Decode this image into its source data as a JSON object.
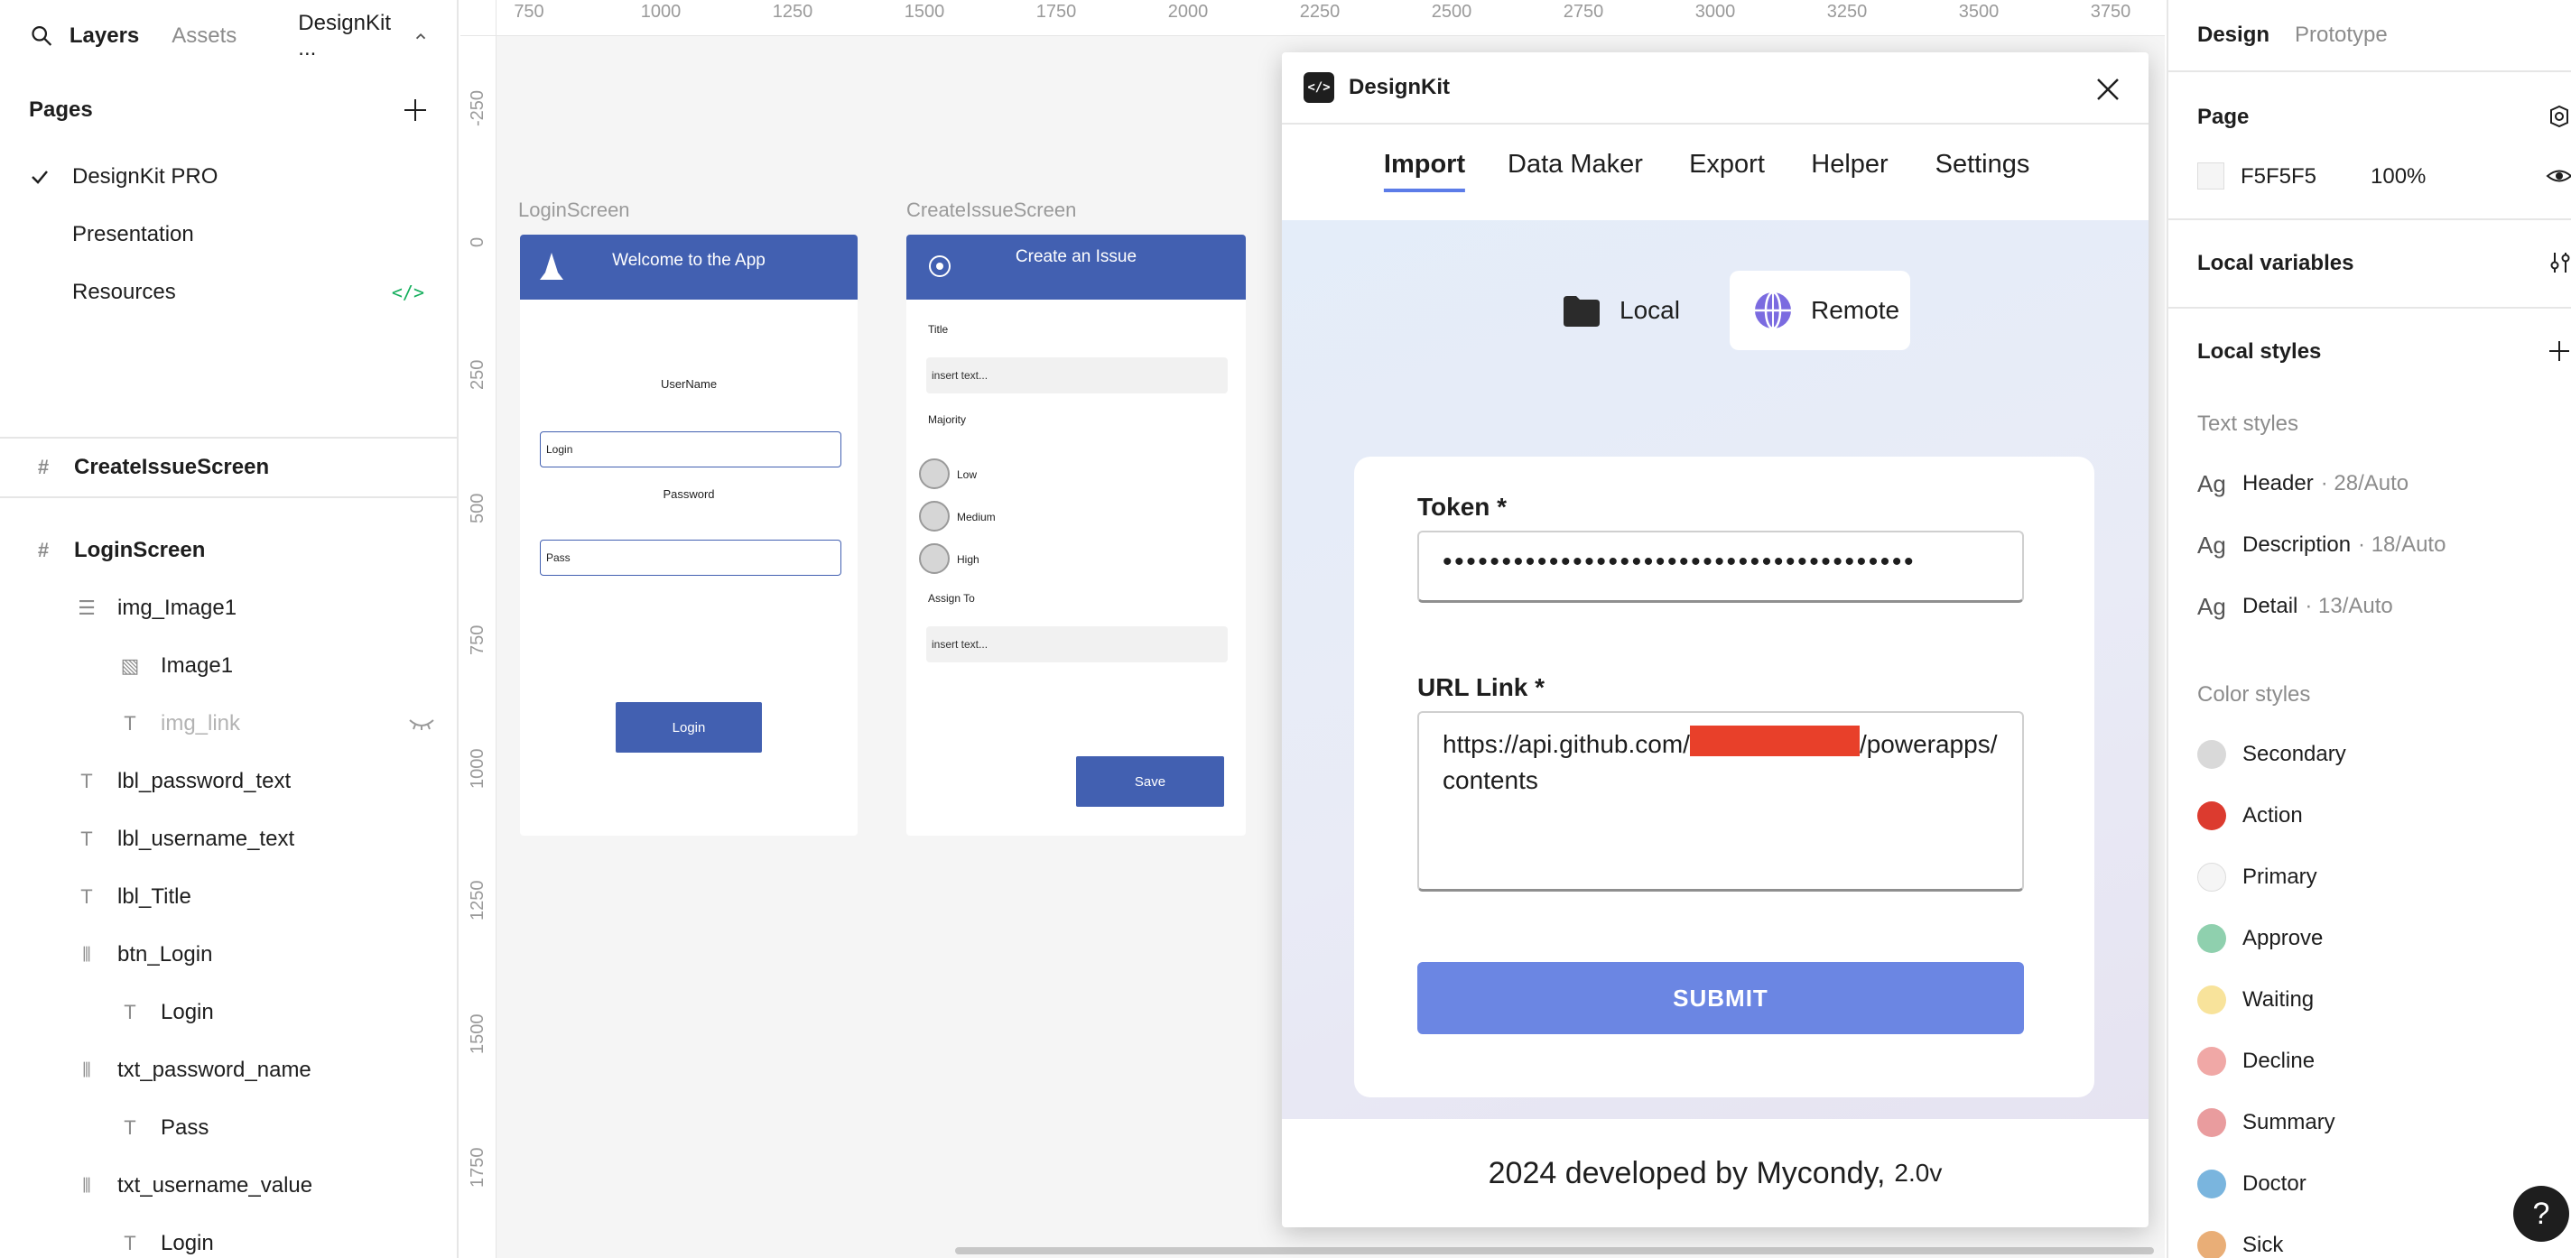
{
  "left_panel": {
    "tabs": {
      "layers": "Layers",
      "assets": "Assets"
    },
    "file_name": "DesignKit ...",
    "pages_heading": "Pages",
    "pages": [
      {
        "label": "DesignKit PRO",
        "selected": true
      },
      {
        "label": "Presentation",
        "selected": false
      },
      {
        "label": "Resources",
        "selected": false,
        "badge": "</>"
      }
    ],
    "layers": [
      {
        "label": "CreateIssueScreen",
        "kind": "frame"
      },
      {
        "label": "LoginScreen",
        "kind": "frame"
      },
      {
        "label": "img_Image1",
        "kind": "group"
      },
      {
        "label": "Image1",
        "kind": "image"
      },
      {
        "label": "img_link",
        "kind": "text",
        "hidden": true
      },
      {
        "label": "lbl_password_text",
        "kind": "text"
      },
      {
        "label": "lbl_username_text",
        "kind": "text"
      },
      {
        "label": "lbl_Title",
        "kind": "text"
      },
      {
        "label": "btn_Login",
        "kind": "auto-layout"
      },
      {
        "label": "Login",
        "kind": "text"
      },
      {
        "label": "txt_password_name",
        "kind": "auto-layout"
      },
      {
        "label": "Pass",
        "kind": "text"
      },
      {
        "label": "txt_username_value",
        "kind": "auto-layout"
      },
      {
        "label": "Login",
        "kind": "text"
      }
    ]
  },
  "canvas": {
    "background": "#F5F5F5",
    "ruler_x": [
      "750",
      "1000",
      "1250",
      "1500",
      "1750",
      "2000",
      "2250",
      "2500",
      "2750",
      "3000",
      "3250",
      "3500",
      "3750"
    ],
    "ruler_y": [
      "-250",
      "0",
      "250",
      "500",
      "750",
      "1000",
      "1250",
      "1500",
      "1750"
    ],
    "login_screen": {
      "frame_label": "LoginScreen",
      "header": "Welcome to the App",
      "username_label": "UserName",
      "username_value": "Login",
      "password_label": "Password",
      "password_value": "Pass",
      "button": "Login"
    },
    "create_issue_screen": {
      "frame_label": "CreateIssueScreen",
      "header": "Create an Issue",
      "title_label": "Title",
      "title_placeholder": "insert text...",
      "majority_label": "Majority",
      "options": [
        "Low",
        "Medium",
        "High"
      ],
      "assign_label": "Assign To",
      "assign_placeholder": "insert text...",
      "button": "Save"
    }
  },
  "plugin": {
    "title": "DesignKit",
    "logo": "</>",
    "tabs": [
      "Import",
      "Data Maker",
      "Export",
      "Helper",
      "Settings"
    ],
    "active_tab": "Import",
    "sources": {
      "local": "Local",
      "remote": "Remote",
      "selected": "Remote"
    },
    "token_label": "Token *",
    "token_value": "••••••••••••••••••••••••••••••••••••••••",
    "url_label": "URL Link *",
    "url_prefix": "https://api.github.com/",
    "url_suffix": "/powerapps/contents",
    "submit": "SUBMIT",
    "footer": "2024 developed by Mycondy,",
    "version": "2.0v",
    "accent": "#6B86E3"
  },
  "right_panel": {
    "tabs": {
      "design": "Design",
      "prototype": "Prototype"
    },
    "page_heading": "Page",
    "page_color": "F5F5F5",
    "page_opacity": "100%",
    "local_variables": "Local variables",
    "local_styles": "Local styles",
    "text_styles_heading": "Text styles",
    "text_styles": [
      {
        "name": "Header",
        "meta": "· 28/Auto"
      },
      {
        "name": "Description",
        "meta": "· 18/Auto"
      },
      {
        "name": "Detail",
        "meta": "· 13/Auto"
      }
    ],
    "text_style_glyph": "Ag",
    "color_styles_heading": "Color styles",
    "color_styles": [
      {
        "name": "Secondary",
        "color": "#D9D9D9"
      },
      {
        "name": "Action",
        "color": "#DC3B2F"
      },
      {
        "name": "Primary",
        "color": "#F5F5F5"
      },
      {
        "name": "Approve",
        "color": "#8FD0AE"
      },
      {
        "name": "Waiting",
        "color": "#F8E39B"
      },
      {
        "name": "Decline",
        "color": "#F0A8A6"
      },
      {
        "name": "Summary",
        "color": "#E99C9E"
      },
      {
        "name": "Doctor",
        "color": "#7AB5DE"
      },
      {
        "name": "Sick",
        "color": "#E9AE77"
      }
    ]
  },
  "help_button": "?"
}
